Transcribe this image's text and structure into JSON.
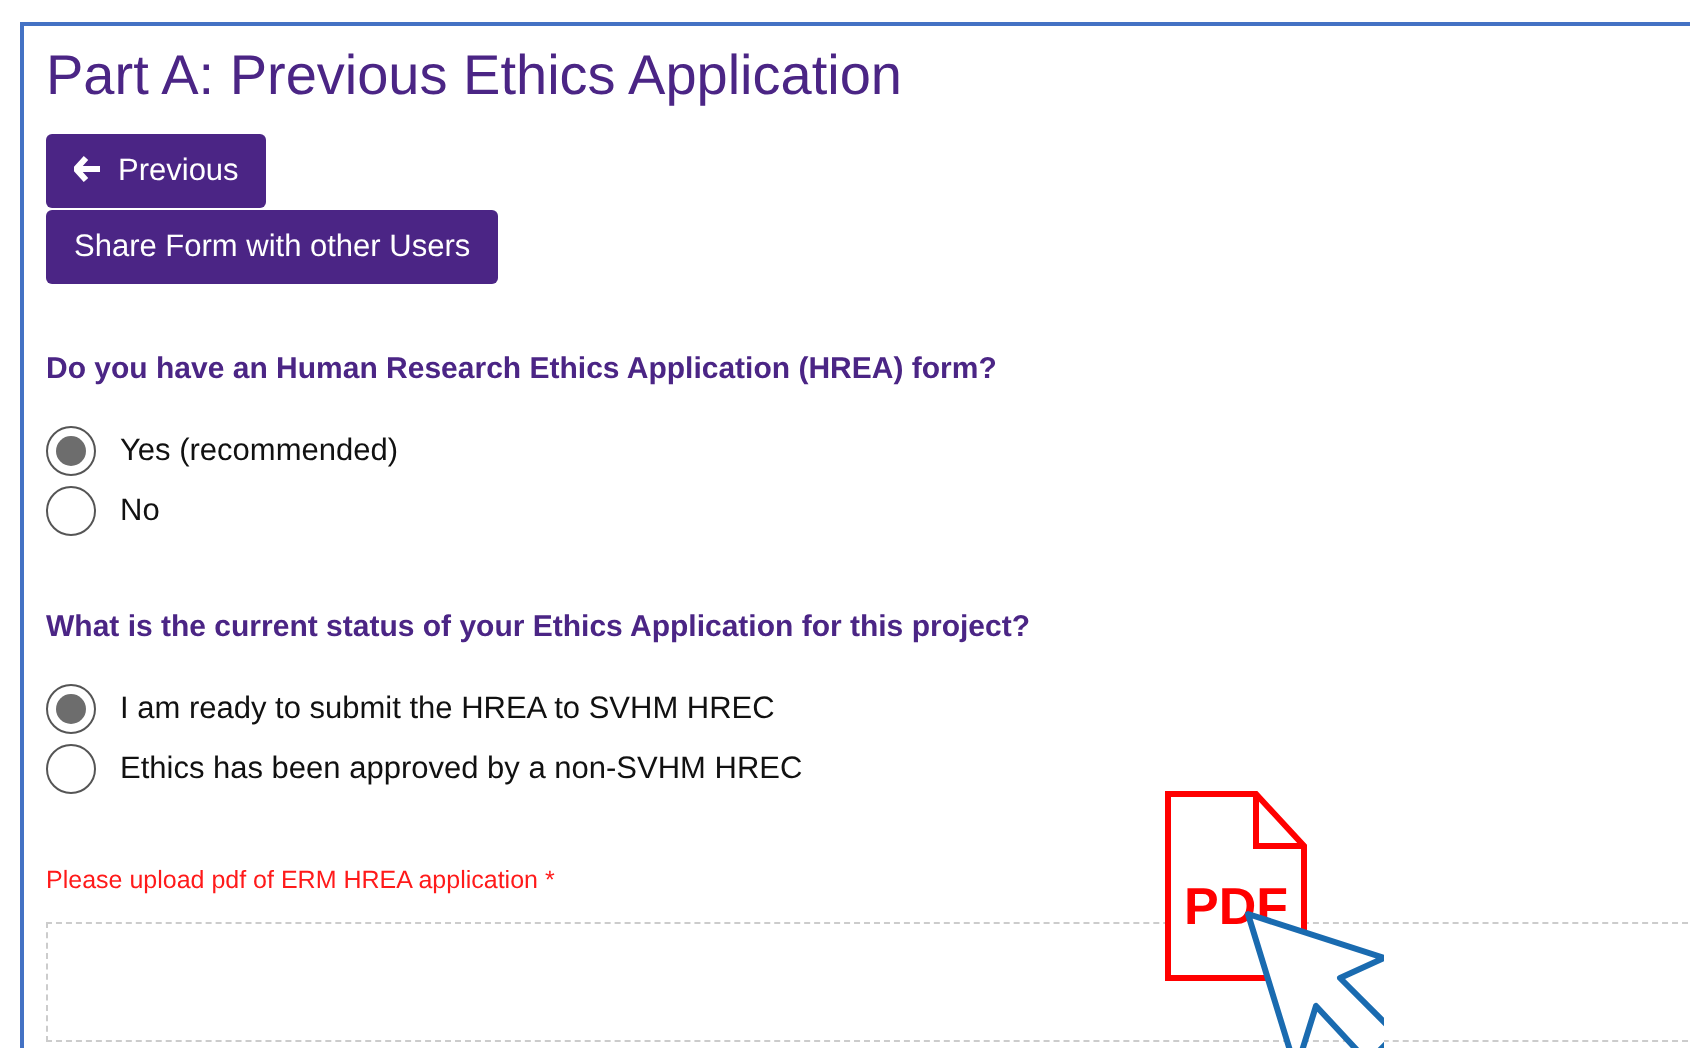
{
  "title": "Part A: Previous Ethics Application",
  "buttons": [
    {
      "kind": "back",
      "label": "Previous"
    },
    {
      "kind": "plain",
      "label": "Share Form with other Users"
    }
  ],
  "questions": [
    {
      "label": "Do you have an Human Research Ethics Application (HREA) form?",
      "options": [
        {
          "label": "Yes (recommended)",
          "selected": true
        },
        {
          "label": "No",
          "selected": false
        }
      ]
    },
    {
      "label": "What is the current status of your Ethics Application for this project?",
      "options": [
        {
          "label": "I am ready to submit the HREA to SVHM HREC",
          "selected": true
        },
        {
          "label": "Ethics has been approved by a non-SVHM HREC",
          "selected": false
        }
      ]
    }
  ],
  "upload": {
    "label": "Please upload pdf of ERM HREA application *",
    "icon_text": "PDF"
  }
}
